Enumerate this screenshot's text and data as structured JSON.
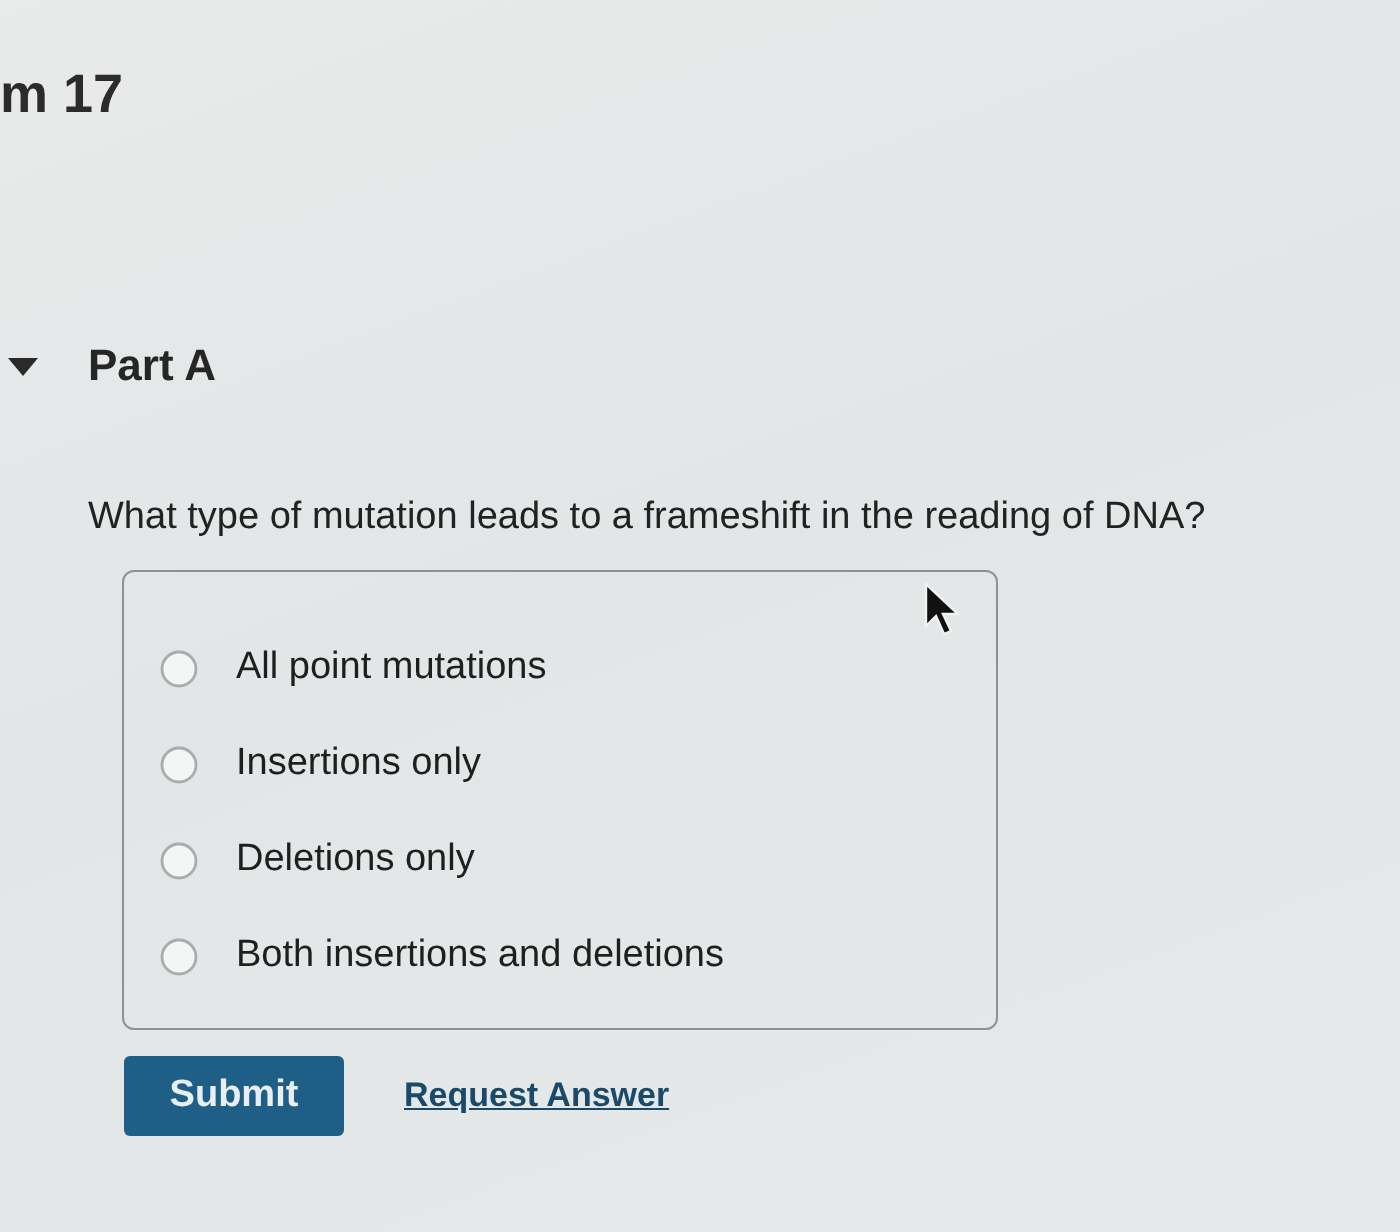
{
  "header": {
    "title": "m 17"
  },
  "part": {
    "label": "Part A",
    "expanded": true
  },
  "question": {
    "text": "What type of mutation leads to a frameshift in the reading of DNA?"
  },
  "options": [
    {
      "label": "All point mutations",
      "selected": false
    },
    {
      "label": "Insertions only",
      "selected": false
    },
    {
      "label": "Deletions only",
      "selected": false
    },
    {
      "label": "Both insertions and deletions",
      "selected": false
    }
  ],
  "actions": {
    "submit": "Submit",
    "request_answer": "Request Answer"
  }
}
